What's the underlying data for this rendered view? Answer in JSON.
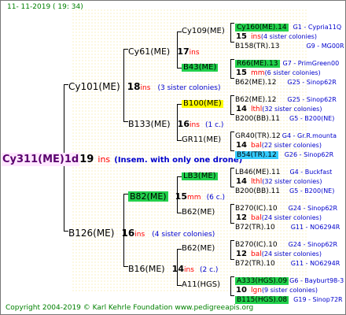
{
  "date": "11- 11-2019 ( 19: 34)",
  "copyright": "Copyright 2004-2019 © Karl Kehrle Foundation    www.pedigreeapis.org",
  "root": {
    "name": "Cy311(ME)1d",
    "num": "19",
    "ins": "ins",
    "note": "(Insem. with only one drone)"
  },
  "gen1": [
    {
      "name": "Cy101(ME)",
      "num": "18",
      "ins": "ins",
      "note": "(3 sister colonies)"
    },
    {
      "name": "B126(ME)",
      "num": "16",
      "ins": "ins",
      "note": "(4 sister colonies)"
    }
  ],
  "gen2": [
    {
      "name": "Cy61(ME)",
      "num": "17",
      "ins": "ins",
      "note": ""
    },
    {
      "name": "B133(ME)",
      "num": "16",
      "ins": "ins",
      "note": "(1 c.)"
    },
    {
      "name": "B82(ME)",
      "num": "15",
      "ins": "mm",
      "note": "(6 c.)"
    },
    {
      "name": "B16(ME)",
      "num": "14",
      "ins": "ins",
      "note": "(2 c.)"
    }
  ],
  "gen3": [
    {
      "name": "Cy109(ME)",
      "num": "15",
      "ins": "ins",
      "note": "(4 sister colonies)"
    },
    {
      "name": "B43(ME)",
      "num": "",
      "ins": "",
      "note": ""
    },
    {
      "name": "B100(ME)",
      "num": "14",
      "ins": "lthl",
      "note": "(32 sister colonies)"
    },
    {
      "name": "GR11(ME)",
      "num": "14",
      "ins": "bal",
      "note": "(22 sister colonies)"
    },
    {
      "name": "LB3(ME)",
      "num": "14",
      "ins": "lthl",
      "note": "(32 sister colonies)"
    },
    {
      "name": "B62(ME)",
      "num": "12",
      "ins": "bal",
      "note": "(24 sister colonies)"
    },
    {
      "name": "B62(ME)",
      "num": "12",
      "ins": "bal",
      "note": "(24 sister colonies)"
    },
    {
      "name": "A11(HGS)",
      "num": "10",
      "ins": "lgn",
      "note": "(9 sister colonies)"
    }
  ],
  "gen4": [
    {
      "name": "Cy160(ME).14",
      "origin": "G1 - Cypria11Q"
    },
    {
      "name": "B158(TR).13",
      "origin": "G9 - MG00R"
    },
    {
      "name": "R66(ME).13",
      "origin": "G7 - PrimGreen00"
    },
    {
      "name": "B62(ME).12",
      "origin": "G25 - Sinop62R"
    },
    {
      "name": "B62(ME).12",
      "origin": "G25 - Sinop62R"
    },
    {
      "name": "B200(BB).11",
      "origin": "G5 - B200(NE)"
    },
    {
      "name": "GR40(TR).12",
      "origin": "G4 - Gr.R.mounta"
    },
    {
      "name": "B54(TR).12",
      "origin": "G26 - Sinop62R"
    },
    {
      "name": "LB46(ME).11",
      "origin": "G4 - Buckfast"
    },
    {
      "name": "B200(BB).11",
      "origin": "G5 - B200(NE)"
    },
    {
      "name": "B270(IC).10",
      "origin": "G24 - Sinop62R"
    },
    {
      "name": "B72(TR).10",
      "origin": "G11 - NO6294R"
    },
    {
      "name": "B270(IC).10",
      "origin": "G24 - Sinop62R"
    },
    {
      "name": "B72(TR).10",
      "origin": "G11 - NO6294R"
    },
    {
      "name": "A333(HGS).09",
      "origin": "G6 - Bayburt98-3"
    },
    {
      "name": "B115(HGS).08",
      "origin": "G19 - Sinop72R"
    }
  ]
}
